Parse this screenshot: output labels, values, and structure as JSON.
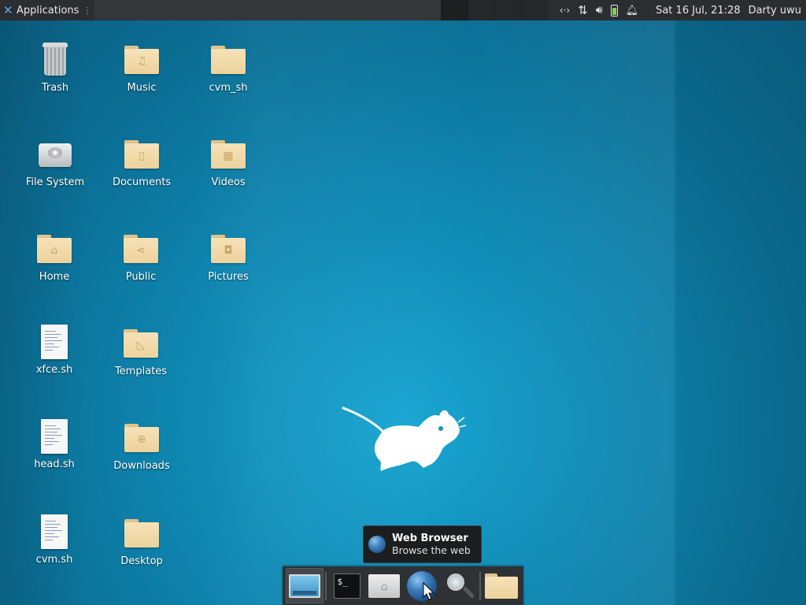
{
  "top_panel": {
    "applications_label": "Applications",
    "applications_icon": "xfce-logo-icon",
    "clock": "Sat 16 Jul, 21:28",
    "user": "Darty uwu",
    "tray_icons": [
      "network-icon",
      "transfer-arrows-icon",
      "volume-icon",
      "battery-icon",
      "notification-bell-icon"
    ]
  },
  "desktop": {
    "icons": [
      {
        "label": "Trash",
        "icon": "trash-icon"
      },
      {
        "label": "Music",
        "icon": "music-folder-icon"
      },
      {
        "label": "cvm_sh",
        "icon": "folder-icon"
      },
      {
        "label": "File System",
        "icon": "drive-icon"
      },
      {
        "label": "Documents",
        "icon": "documents-folder-icon"
      },
      {
        "label": "Videos",
        "icon": "videos-folder-icon"
      },
      {
        "label": "Home",
        "icon": "home-folder-icon"
      },
      {
        "label": "Public",
        "icon": "public-folder-icon"
      },
      {
        "label": "Pictures",
        "icon": "pictures-folder-icon"
      },
      {
        "label": "xfce.sh",
        "icon": "script-file-icon"
      },
      {
        "label": "Templates",
        "icon": "templates-folder-icon"
      },
      {
        "label": "head.sh",
        "icon": "script-file-icon"
      },
      {
        "label": "Downloads",
        "icon": "downloads-folder-icon"
      },
      {
        "label": "cvm.sh",
        "icon": "script-file-icon"
      },
      {
        "label": "Desktop",
        "icon": "folder-icon"
      }
    ]
  },
  "tooltip": {
    "title": "Web Browser",
    "subtitle": "Browse the web"
  },
  "dock": {
    "items": [
      "show-desktop-icon",
      "terminal-icon",
      "home-folder-icon",
      "web-browser-icon",
      "search-icon",
      "file-manager-icon"
    ],
    "terminal_glyph": "$_"
  },
  "colors": {
    "panel": "#2b2e31",
    "desktop_accent": "#0f8ab5",
    "folder": "#f3deb0"
  }
}
